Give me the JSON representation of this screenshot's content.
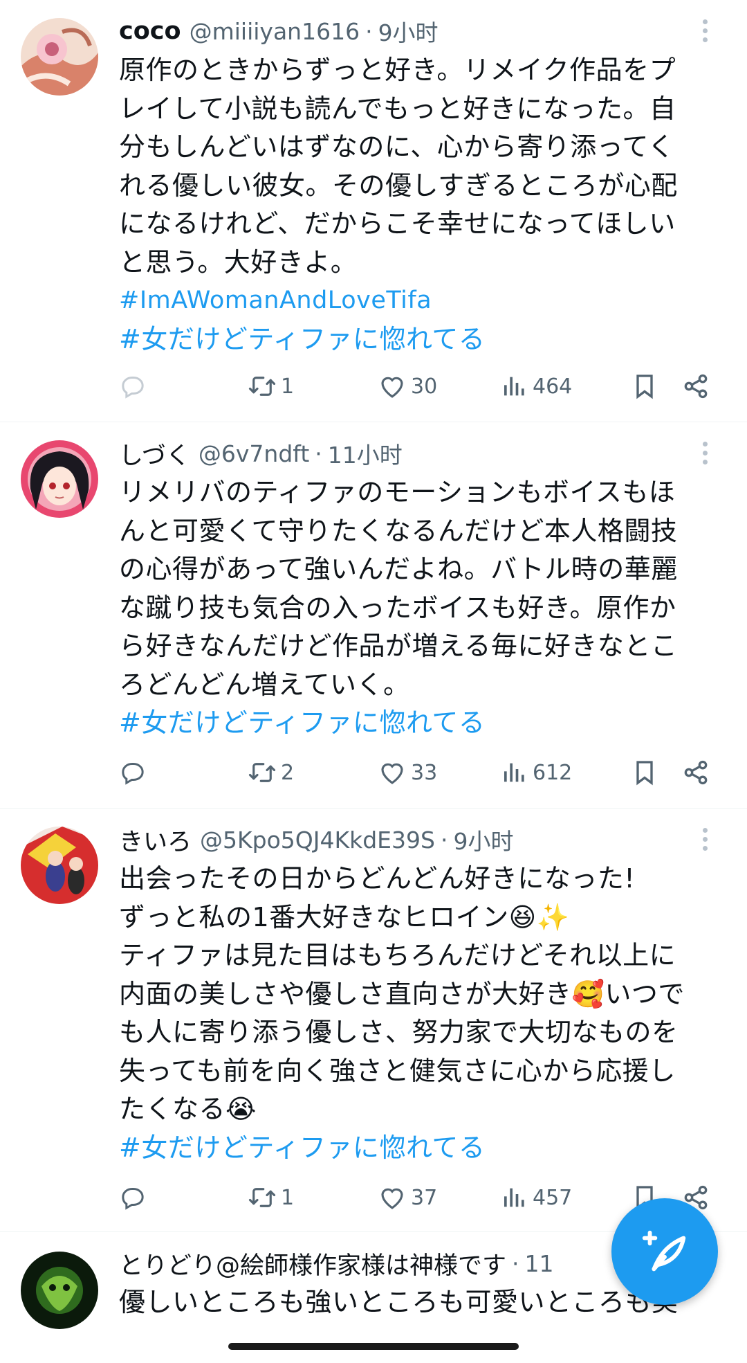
{
  "tweets": [
    {
      "display_name": "coco",
      "handle": "@miiiiyan1616",
      "separator": "·",
      "time": "9小时",
      "text_lines": [
        "原作のときからずっと好き。リメイク作品をプ",
        "レイして小説も読んでもっと好きになった。自",
        "分もしんどいはずなのに、心から寄り添ってく",
        "れる優しい彼女。その優しすぎるところが心配",
        "になるけれど、だからこそ幸せになってほしい",
        "と思う。大好きよ。"
      ],
      "hashtags": [
        "#ImAWomanAndLoveTifa",
        "#女だけどティファに惚れてる"
      ],
      "reply_count": "",
      "retweet_count": "1",
      "like_count": "30",
      "view_count": "464"
    },
    {
      "display_name": "しづく",
      "handle": "@6v7ndft",
      "separator": "·",
      "time": "11小时",
      "text_lines": [
        "リメリバのティファのモーションもボイスもほ",
        "んと可愛くて守りたくなるんだけど本人格闘技",
        "の心得があって強いんだよね。バトル時の華麗",
        "な蹴り技も気合の入ったボイスも好き。原作か",
        "ら好きなんだけど作品が増える毎に好きなとこ",
        "ろどんどん増えていく。"
      ],
      "hashtags": [
        "#女だけどティファに惚れてる"
      ],
      "reply_count": "",
      "retweet_count": "2",
      "like_count": "33",
      "view_count": "612"
    },
    {
      "display_name": "きいろ",
      "handle": "@5Kpo5QJ4KkdE39S",
      "separator": "·",
      "time": "9小时",
      "text_lines": [
        "出会ったその日からどんどん好きになった!",
        "ずっと私の1番大好きなヒロイン😆✨",
        "ティファは見た目はもちろんだけどそれ以上に",
        "内面の美しさや優しさ直向さが大好き🥰いつで",
        "も人に寄り添う優しさ、努力家で大切なものを",
        "失っても前を向く強さと健気さに心から応援し",
        "たくなる😭"
      ],
      "hashtags": [
        "#女だけどティファに惚れてる"
      ],
      "reply_count": "",
      "retweet_count": "1",
      "like_count": "37",
      "view_count": "457"
    },
    {
      "display_name": "とりどり@絵師様作家様は神様です",
      "separator": "·",
      "time_partial": "11",
      "text_lines": [
        "優しいところも強いところも可愛いところも美"
      ]
    }
  ],
  "icons": {
    "reply": "reply-icon",
    "retweet": "retweet-icon",
    "like": "heart-icon",
    "views": "views-icon",
    "bookmark": "bookmark-icon",
    "share": "share-icon",
    "more": "more-options-icon",
    "compose": "compose-icon"
  },
  "colors": {
    "link": "#1d9bf0",
    "secondary_text": "#536471",
    "fab": "#1d9bf0"
  }
}
